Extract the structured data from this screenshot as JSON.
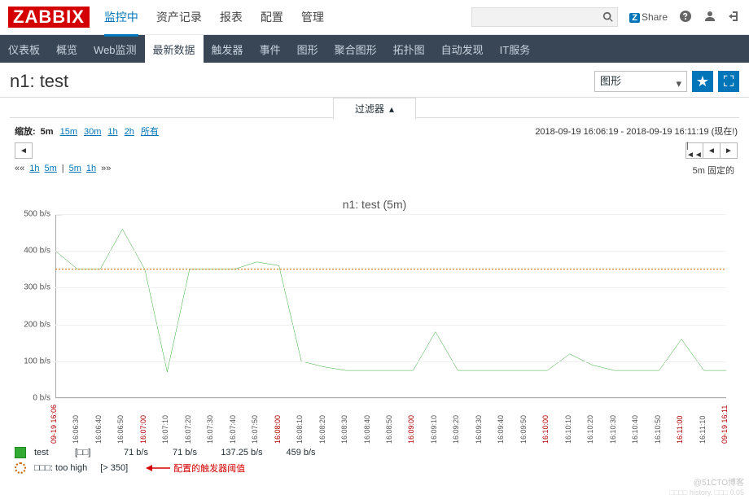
{
  "header": {
    "logo": "ZABBIX",
    "nav": [
      "监控中",
      "资产记录",
      "报表",
      "配置",
      "管理"
    ],
    "nav_active_index": 0,
    "share": "Share"
  },
  "subnav": {
    "items": [
      "仪表板",
      "概览",
      "Web监测",
      "最新数据",
      "触发器",
      "事件",
      "图形",
      "聚合图形",
      "拓扑图",
      "自动发现",
      "IT服务"
    ],
    "active_index": 3
  },
  "title": "n1: test",
  "view_select": "图形",
  "filter_tab": "过滤器",
  "zoom": {
    "label": "缩放:",
    "options": [
      "5m",
      "15m",
      "30m",
      "1h",
      "2h",
      "所有"
    ],
    "active": "5m",
    "range": "2018-09-19 16:06:19 - 2018-09-19 16:11:19 (现在!)"
  },
  "shift": {
    "left_pre": [
      "««",
      "1h",
      "5m",
      "|",
      "5m",
      "1h",
      "»»"
    ],
    "right_label": "5m  固定的"
  },
  "chart_data": {
    "type": "line",
    "title": "n1: test (5m)",
    "ylabel": "",
    "ylim": [
      0,
      500
    ],
    "yticks": [
      0,
      100,
      200,
      300,
      400,
      500
    ],
    "ytick_labels": [
      "0 b/s",
      "100 b/s",
      "200 b/s",
      "300 b/s",
      "400 b/s",
      "500 b/s"
    ],
    "trigger_threshold": 350,
    "x": [
      "09-19 16:06",
      "16:06:30",
      "16:06:40",
      "16:06:50",
      "16:07:00",
      "16:07:10",
      "16:07:20",
      "16:07:30",
      "16:07:40",
      "16:07:50",
      "16:08:00",
      "16:08:10",
      "16:08:20",
      "16:08:30",
      "16:08:40",
      "16:08:50",
      "16:09:00",
      "16:09:10",
      "16:09:20",
      "16:09:30",
      "16:09:40",
      "16:09:50",
      "16:10:00",
      "16:10:10",
      "16:10:20",
      "16:10:30",
      "16:10:40",
      "16:10:50",
      "16:11:00",
      "16:11:10",
      "09-19 16:11"
    ],
    "x_red_indices": [
      0,
      4,
      10,
      16,
      22,
      28,
      30
    ],
    "series": [
      {
        "name": "test",
        "color": "#33aa33",
        "values": [
          400,
          350,
          350,
          459,
          350,
          71,
          350,
          350,
          350,
          370,
          360,
          100,
          85,
          75,
          75,
          75,
          75,
          180,
          75,
          75,
          75,
          75,
          75,
          120,
          90,
          75,
          75,
          75,
          160,
          75,
          75
        ]
      }
    ]
  },
  "legend": {
    "headers": [
      "",
      "[□□]",
      "□□",
      "□□",
      "□□□",
      "□□"
    ],
    "row1": {
      "name": "test",
      "c1": "[□□]",
      "c2": "71 b/s",
      "c3": "71 b/s",
      "c4": "137.25 b/s",
      "c5": "459 b/s"
    },
    "row2": {
      "name": "□□□: too high",
      "cond": "[> 350]"
    },
    "annotation": "配置的触发器阈值"
  },
  "watermark": "@51CTO博客",
  "watermark2": "□□□□ history. □□□ 0.05"
}
